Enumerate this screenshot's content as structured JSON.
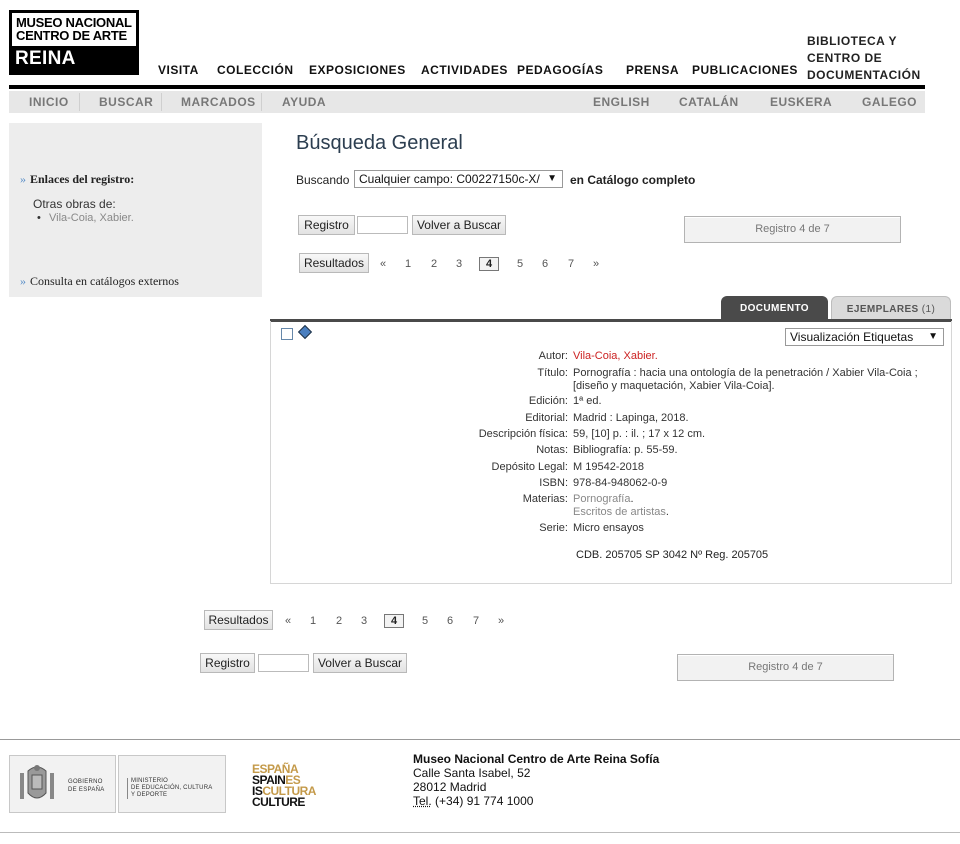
{
  "logo": {
    "line1": "MUSEO NACIONAL",
    "line2": "CENTRO DE ARTE",
    "line3": "REINA SOFIA"
  },
  "mainnav": {
    "visita": "VISITA",
    "coleccion": "COLECCIÓN",
    "exposiciones": "EXPOSICIONES",
    "actividades": "ACTIVIDADES",
    "pedagogias": "PEDAGOGÍAS",
    "prensa": "PRENSA",
    "publicaciones": "PUBLICACIONES",
    "biblioteca_1": "BIBLIOTECA Y",
    "biblioteca_2": "CENTRO DE",
    "biblioteca_3": "DOCUMENTACIÓN"
  },
  "subnav": {
    "inicio": "INICIO",
    "buscar": "BUSCAR",
    "marcados": "MARCADOS",
    "ayuda": "AYUDA",
    "english": "ENGLISH",
    "catalan": "CATALÁN",
    "euskera": "EUSKERA",
    "galego": "GALEGO"
  },
  "sidebar": {
    "enlaces": "Enlaces del registro:",
    "otras": "Otras obras de:",
    "autor_link": "Vila-Coia, Xabier.",
    "externos": "Consulta en catálogos externos"
  },
  "search": {
    "title": "Búsqueda General",
    "buscando": "Buscando",
    "field_value": "Cualquier campo: C00227150c-X/",
    "en": "en Catálogo completo"
  },
  "controls": {
    "registro": "Registro",
    "volver": "Volver a Buscar",
    "registro_de": "Registro 4 de 7",
    "resultados": "Resultados",
    "prev": "«",
    "next": "»",
    "pages": [
      "1",
      "2",
      "3",
      "4",
      "5",
      "6",
      "7"
    ],
    "current": "4"
  },
  "tabs": {
    "documento": "DOCUMENTO",
    "ejemplares": "EJEMPLARES",
    "ejemplares_count": "(1)"
  },
  "view": {
    "selected": "Visualización Etiquetas"
  },
  "record": {
    "autor_l": "Autor:",
    "autor_v": "Vila-Coia, Xabier.",
    "titulo_l": "Título:",
    "titulo_v1": "Pornografía : hacia una ontología de la penetración / Xabier Vila-Coia ;",
    "titulo_v2": "[diseño y maquetación, Xabier Vila-Coia].",
    "edicion_l": "Edición:",
    "edicion_v": "1ª ed.",
    "editorial_l": "Editorial:",
    "editorial_v": "Madrid : Lapinga, 2018.",
    "desc_l": "Descripción física:",
    "desc_v": "59, [10] p. : il. ; 17 x 12 cm.",
    "notas_l": "Notas:",
    "notas_v": "Bibliografía: p. 55-59.",
    "deposito_l": "Depósito Legal:",
    "deposito_v": "M 19542-2018",
    "isbn_l": "ISBN:",
    "isbn_v": "978-84-948062-0-9",
    "materias_l": "Materias:",
    "materias_v1": "Pornografía",
    "materias_v2": "Escritos de artistas",
    "serie_l": "Serie:",
    "serie_v": "Micro ensayos",
    "cdb": "CDB. 205705 SP 3042 Nº Reg. 205705"
  },
  "footer": {
    "gobierno": "GOBIERNO\nDE ESPAÑA",
    "ministerio": "MINISTERIO\nDE EDUCACIÓN, CULTURA\nY DEPORTE",
    "spain1": "ESPAÑA",
    "spain2a": "SPAIN",
    "spain2b": "ES",
    "spain3a": "IS",
    "spain3b": "CULTURA",
    "spain4": "CULTURE",
    "museo": "Museo Nacional Centro de Arte Reina Sofía",
    "calle": "Calle Santa Isabel, 52",
    "ciudad": "28012 Madrid",
    "tel_l": "Tel.",
    "tel_v": " (+34) 91 774 1000"
  }
}
